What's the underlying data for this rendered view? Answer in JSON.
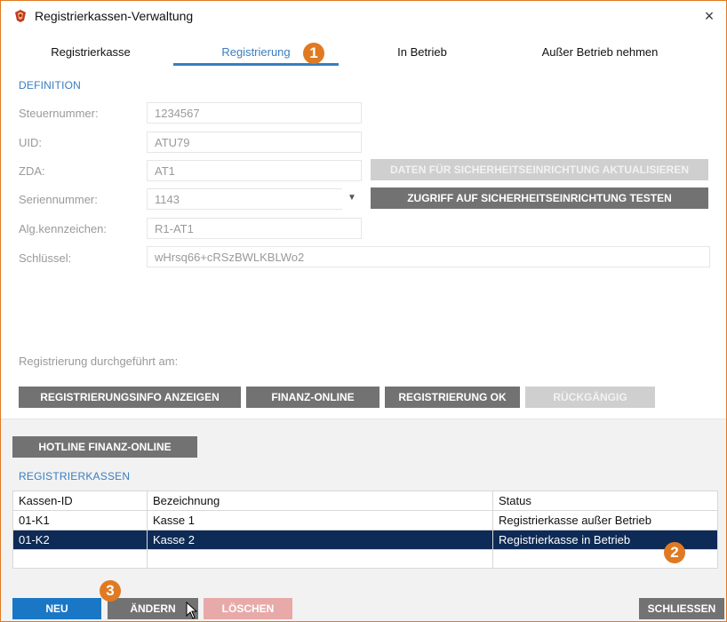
{
  "window": {
    "title": "Registrierkassen-Verwaltung",
    "close_glyph": "×"
  },
  "tabs": [
    {
      "label": "Registrierkasse"
    },
    {
      "label": "Registrierung"
    },
    {
      "label": "In Betrieb"
    },
    {
      "label": "Außer Betrieb nehmen"
    }
  ],
  "badges": {
    "b1": "1",
    "b2": "2",
    "b3": "3"
  },
  "definition": {
    "title": "DEFINITION",
    "steuernummer_label": "Steuernummer:",
    "steuernummer_value": "1234567",
    "uid_label": "UID:",
    "uid_value": "ATU79",
    "zda_label": "ZDA:",
    "zda_value": "AT1",
    "serien_label": "Seriennummer:",
    "serien_value": "1143",
    "alg_label": "Alg.kennzeichen:",
    "alg_value": "R1-AT1",
    "key_label": "Schlüssel:",
    "key_value": "wHrsq66+cRSzBWLKBLWo2",
    "btn_update": "DATEN FÜR SICHERHEITSEINRICHTUNG AKTUALISIEREN",
    "btn_test": "ZUGRIFF AUF SICHERHEITSEINRICHTUNG TESTEN",
    "reg_done_label": "Registrierung durchgeführt am:"
  },
  "actions": {
    "btn_info": "REGISTRIERUNGSINFO ANZEIGEN",
    "btn_finanz": "FINANZ-ONLINE",
    "btn_ok": "REGISTRIERUNG OK",
    "btn_undo": "RÜCKGÄNGIG",
    "btn_hotline": "HOTLINE FINANZ-ONLINE"
  },
  "kassen": {
    "title": "REGISTRIERKASSEN",
    "columns": [
      "Kassen-ID",
      "Bezeichnung",
      "Status"
    ],
    "rows": [
      {
        "id": "01-K1",
        "name": "Kasse 1",
        "status": "Registrierkasse außer Betrieb"
      },
      {
        "id": "01-K2",
        "name": "Kasse 2",
        "status": "Registrierkasse in Betrieb"
      }
    ]
  },
  "footer": {
    "btn_neu": "NEU",
    "btn_aendern": "ÄNDERN",
    "btn_loeschen": "LÖSCHEN",
    "btn_close": "SCHLIESSEN"
  },
  "colors": {
    "accent": "#3a7dbf",
    "badge": "#e07a22",
    "selected_row": "#0e2a56",
    "primary": "#1a77c5"
  }
}
